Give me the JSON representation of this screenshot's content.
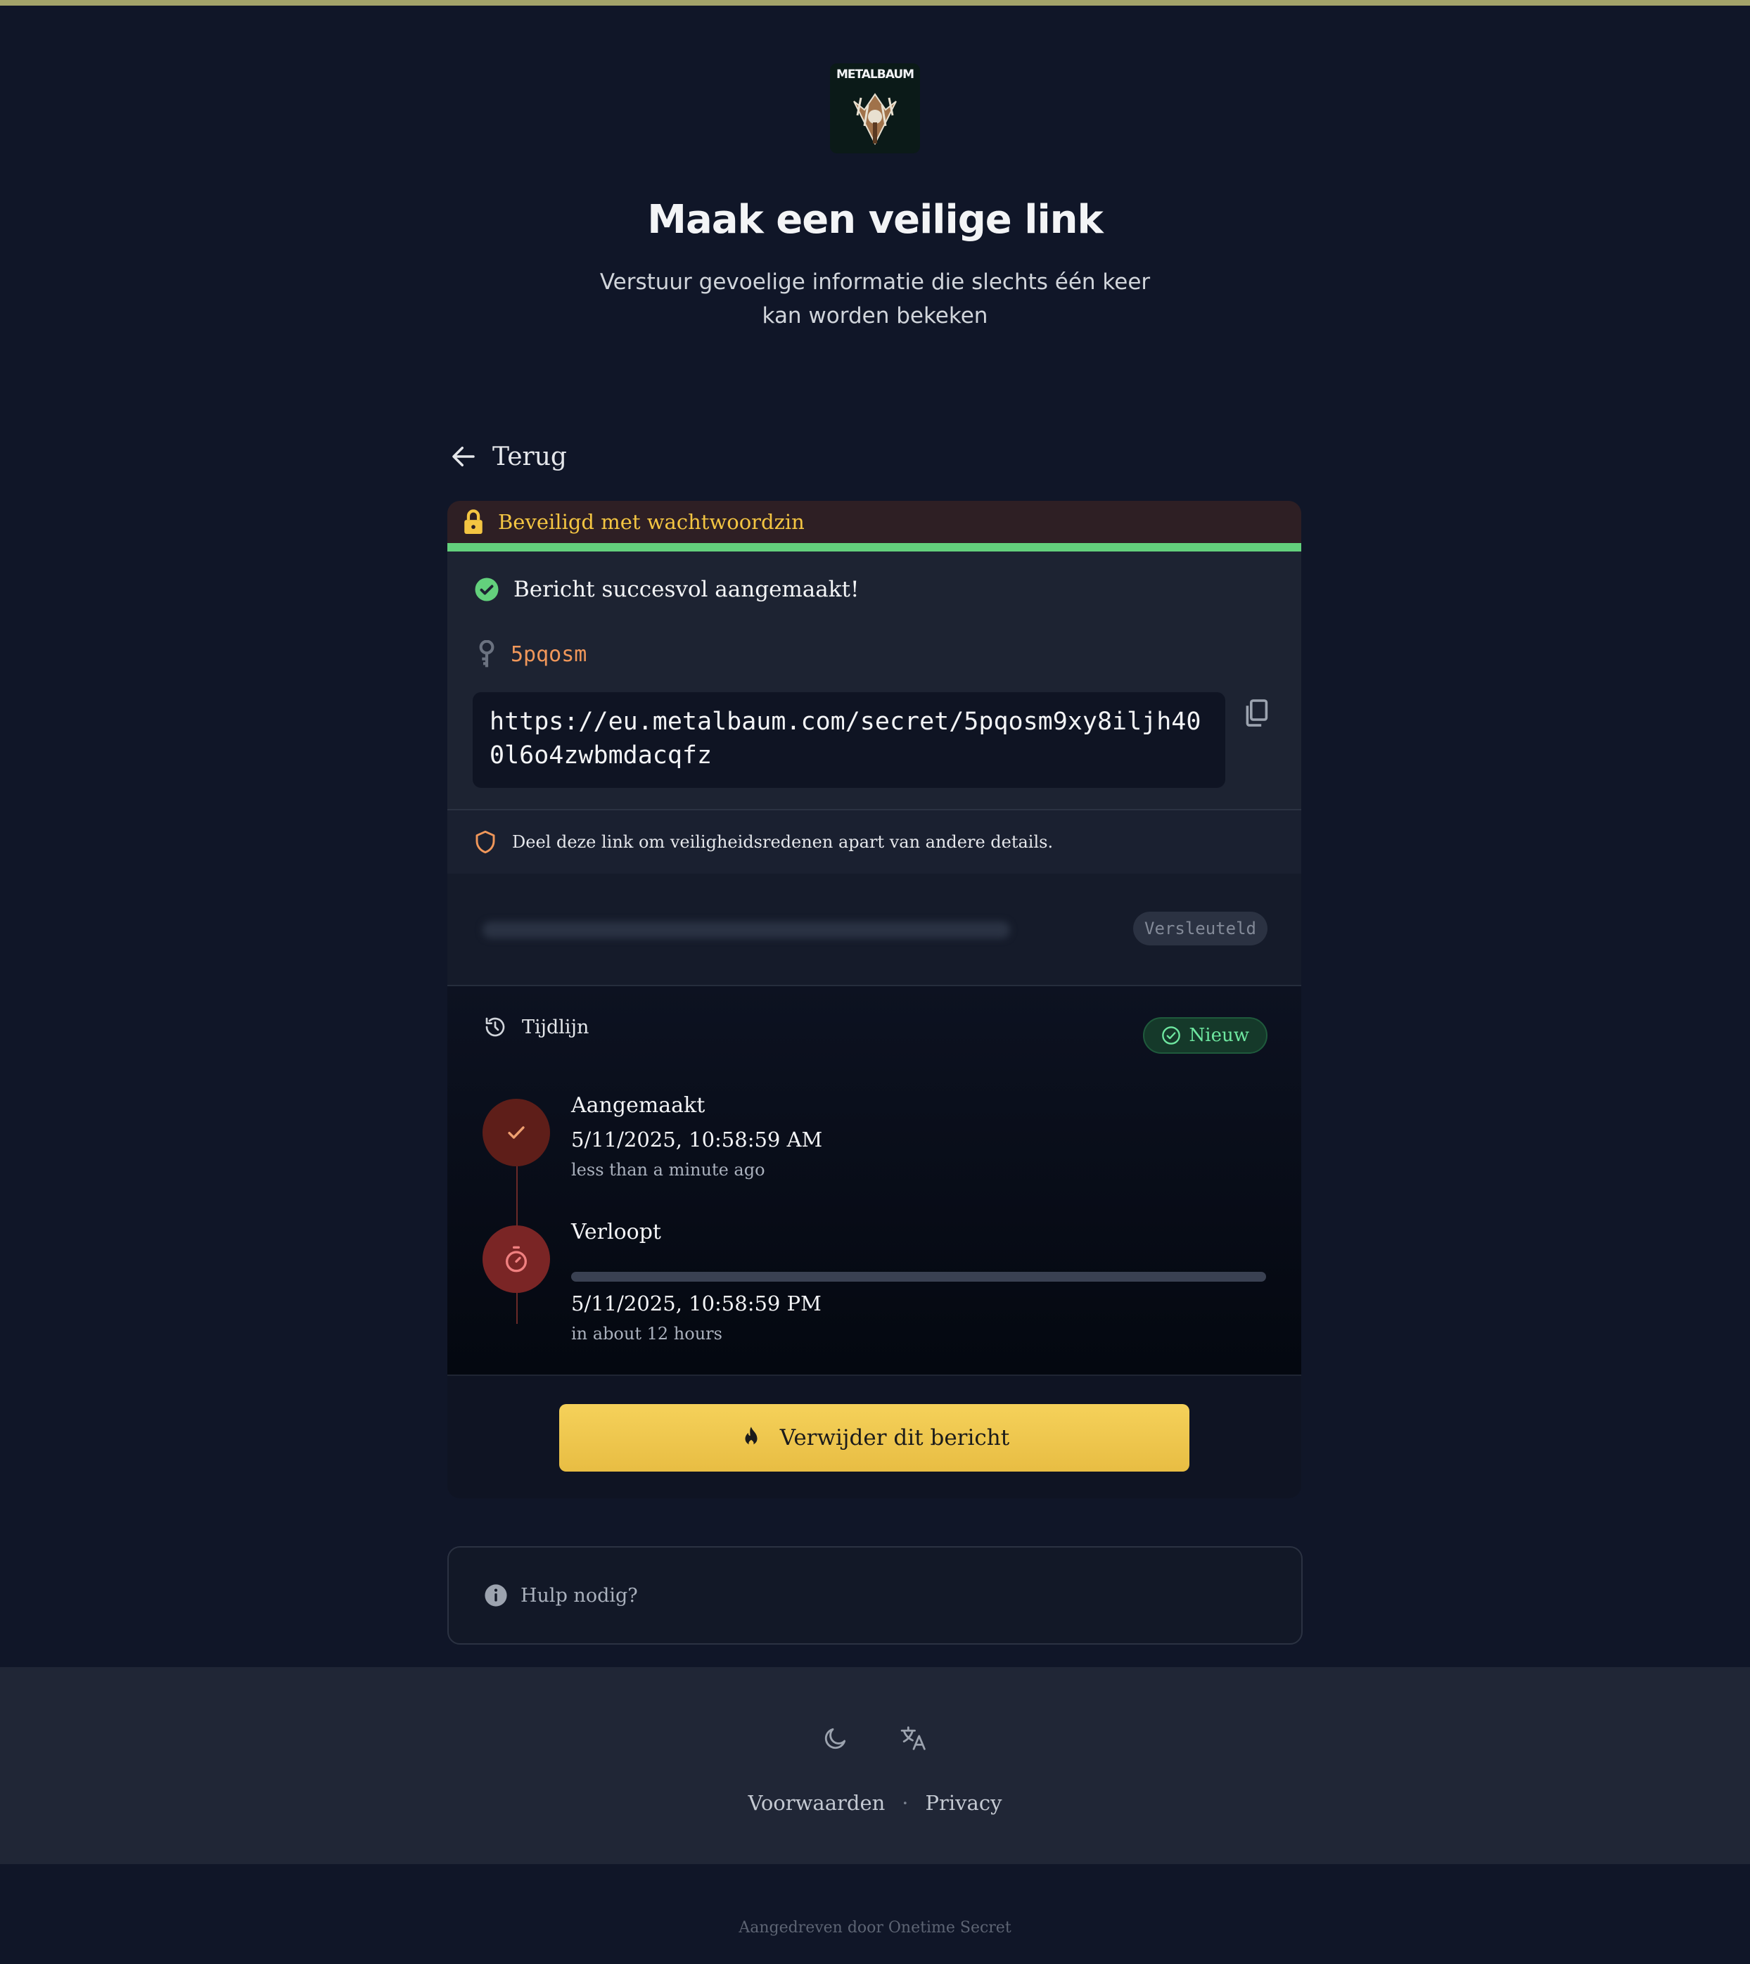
{
  "logo": {
    "text": "METALBAUM"
  },
  "header": {
    "title": "Maak een veilige link",
    "subtitle": "Verstuur gevoelige informatie die slechts één keer kan worden bekeken"
  },
  "nav": {
    "back_label": "Terug"
  },
  "card": {
    "passphrase_banner": "Beveiligd met wachtwoordzin",
    "success_message": "Bericht succesvol aangemaakt!",
    "secret_key": "5pqosm",
    "secret_url": "https://eu.metalbaum.com/secret/5pqosm9xy8iljh400l6o4zwbmdacqfz",
    "share_note": "Deel deze link om veiligheidsredenen apart van andere details.",
    "encrypted_badge": "Versleuteld",
    "timeline": {
      "title": "Tijdlijn",
      "status_badge": "Nieuw",
      "events": [
        {
          "title": "Aangemaakt",
          "date": "5/11/2025, 10:58:59 AM",
          "relative": "less than a minute ago"
        },
        {
          "title": "Verloopt",
          "date": "5/11/2025, 10:58:59 PM",
          "relative": "in about 12 hours"
        }
      ],
      "expiry_progress_percent": 0
    },
    "burn_button": "Verwijder dit bericht"
  },
  "help": {
    "label": "Hulp nodig?"
  },
  "footer": {
    "links": [
      "Voorwaarden",
      "Privacy"
    ],
    "separator": "·",
    "powered_by": "Aangedreven door Onetime Secret"
  },
  "colors": {
    "accent": "#f5d15a",
    "success": "#63d07c",
    "warning": "#f4c542"
  },
  "icons": [
    "lock-icon",
    "check-circle-icon",
    "key-icon",
    "copy-icon",
    "shield-icon",
    "history-icon",
    "check-icon",
    "timer-icon",
    "flame-icon",
    "info-icon",
    "moon-icon",
    "translate-icon",
    "arrow-left-icon"
  ]
}
